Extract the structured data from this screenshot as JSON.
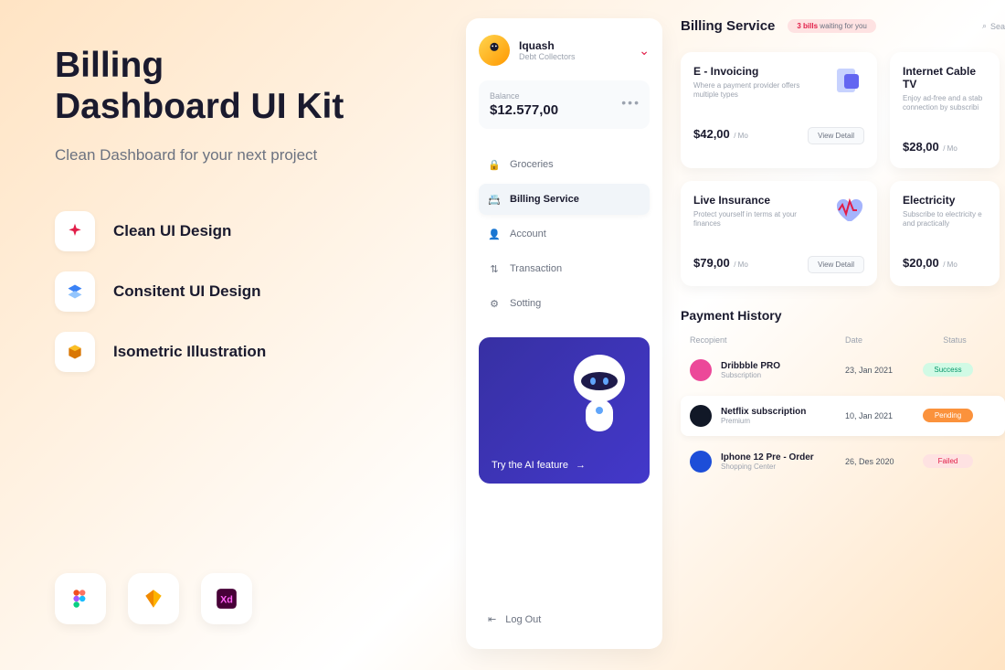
{
  "promo": {
    "title_l1": "Billing",
    "title_l2": "Dashboard UI Kit",
    "subtitle": "Clean Dashboard for your next project",
    "features": [
      {
        "label": "Clean UI Design",
        "color": "#e11d48"
      },
      {
        "label": "Consitent UI Design",
        "color": "#3b82f6"
      },
      {
        "label": "Isometric Illustration",
        "color": "#d97706"
      }
    ],
    "tools": [
      "figma",
      "sketch",
      "xd"
    ]
  },
  "sidebar": {
    "user": {
      "name": "Iquash",
      "role": "Debt Collectors"
    },
    "balance": {
      "label": "Balance",
      "value": "$12.577,00"
    },
    "nav": [
      {
        "icon": "lock",
        "label": "Groceries"
      },
      {
        "icon": "card",
        "label": "Billing Service"
      },
      {
        "icon": "user",
        "label": "Account"
      },
      {
        "icon": "swap",
        "label": "Transaction"
      },
      {
        "icon": "gear",
        "label": "Sotting"
      }
    ],
    "ai": {
      "text": "Try the AI feature",
      "arrow": "→"
    },
    "logout": "Log Out"
  },
  "main": {
    "title": "Billing Service",
    "bills_count": "3 bills",
    "bills_text": "waiting for you",
    "search_placeholder": "Sea",
    "services": [
      {
        "title": "E - Invoicing",
        "desc": "Where a payment provider offers multiple types",
        "price": "$42,00",
        "per": "/ Mo",
        "btn": "View Detail"
      },
      {
        "title": "Internet Cable TV",
        "desc": "Enjoy ad-free and a stab connection by subscribi",
        "price": "$28,00",
        "per": "/ Mo"
      },
      {
        "title": "Live Insurance",
        "desc": "Protect yourself in terms at your finances",
        "price": "$79,00",
        "per": "/ Mo",
        "btn": "View Detail"
      },
      {
        "title": "Electricity",
        "desc": "Subscribe to electricity e and practically",
        "price": "$20,00",
        "per": "/ Mo"
      }
    ],
    "history": {
      "title": "Payment History",
      "cols": {
        "recipient": "Recopient",
        "date": "Date",
        "status": "Status"
      },
      "rows": [
        {
          "name": "Dribbble PRO",
          "sub": "Subscription",
          "date": "23, Jan 2021",
          "status": "Success",
          "color": "#ec4899",
          "badge": "success"
        },
        {
          "name": "Netflix subscription",
          "sub": "Premium",
          "date": "10, Jan 2021",
          "status": "Pending",
          "color": "#111827",
          "badge": "pending"
        },
        {
          "name": "Iphone 12 Pre - Order",
          "sub": "Shopping Center",
          "date": "26, Des 2020",
          "status": "Failed",
          "color": "#1d4ed8",
          "badge": "failed"
        }
      ]
    }
  }
}
